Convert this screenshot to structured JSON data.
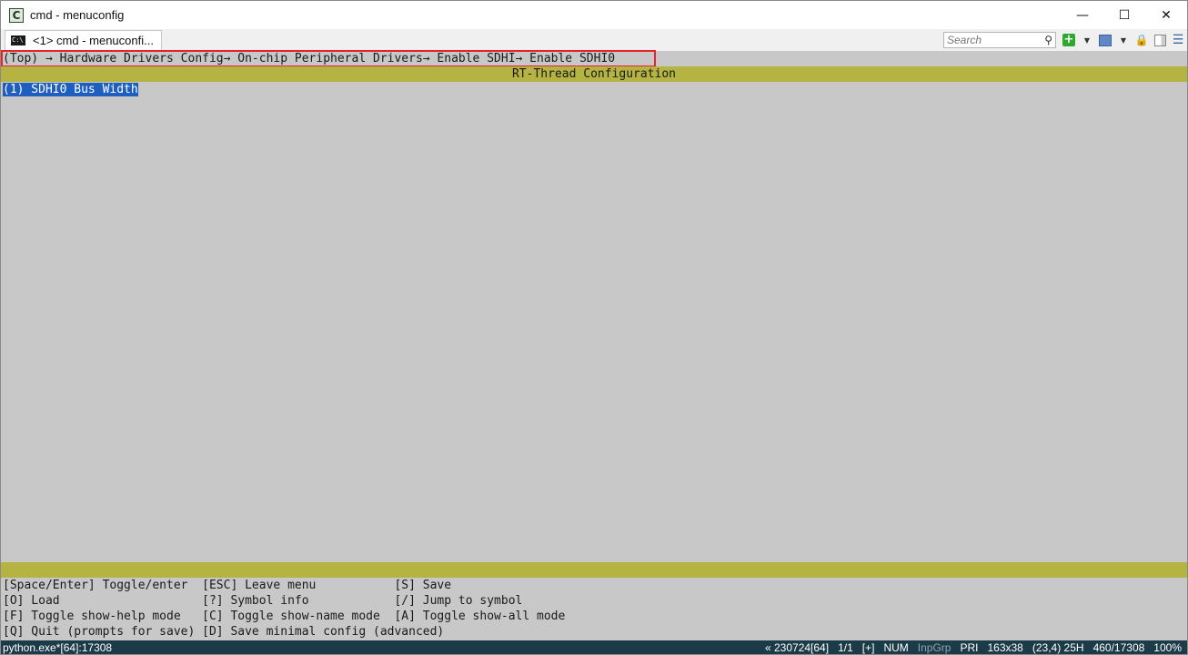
{
  "window": {
    "title": "cmd - menuconfig"
  },
  "tab": {
    "label": "<1> cmd - menuconfi...",
    "icon_text": "C:\\"
  },
  "toolbar": {
    "search_placeholder": "Search"
  },
  "console": {
    "breadcrumb": "(Top) → Hardware Drivers Config→ On-chip Peripheral Drivers→ Enable SDHI→ Enable SDHI0",
    "header": "RT-Thread Configuration",
    "selected_item": "(1) SDHI0 Bus Width",
    "help_lines": [
      "[Space/Enter] Toggle/enter  [ESC] Leave menu           [S] Save",
      "[O] Load                    [?] Symbol info            [/] Jump to symbol",
      "[F] Toggle show-help mode   [C] Toggle show-name mode  [A] Toggle show-all mode",
      "[Q] Quit (prompts for save) [D] Save minimal config (advanced)"
    ]
  },
  "statusbar": {
    "process": "python.exe*[64]:17308",
    "build": "« 230724[64]",
    "page": "1/1",
    "plus": "[+]",
    "num": "NUM",
    "inpgrp": "InpGrp",
    "pri": "PRI",
    "size": "163x38",
    "cursor": "(23,4) 25H",
    "lines": "460/17308",
    "zoom": "100%"
  },
  "colors": {
    "console_bg": "#c8c8c8",
    "header_bar": "#b5b341",
    "selection": "#1d5ec0",
    "highlight_box": "#e8222a",
    "statusbar_bg": "#1b3b49"
  }
}
